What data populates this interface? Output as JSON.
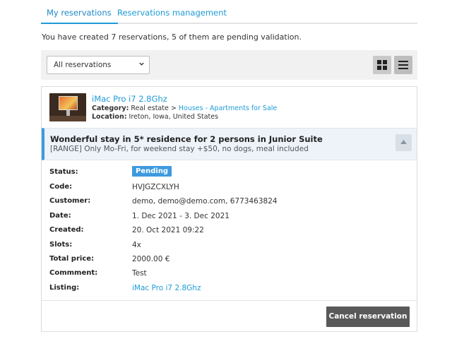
{
  "tabs": [
    {
      "label": "My reservations",
      "active": true
    },
    {
      "label": "Reservations management",
      "active": false
    }
  ],
  "summary": "You have created 7 reservations, 5 of them are pending validation.",
  "filter": {
    "selected": "All reservations",
    "options": [
      "All reservations"
    ]
  },
  "view_toggle": {
    "grid_icon": "grid-view-icon",
    "list_icon": "list-view-icon",
    "active": "list"
  },
  "listing": {
    "title": "iMac Pro i7 2.8Ghz",
    "category_label": "Category:",
    "category_parent": "Real estate",
    "category_separator": ">",
    "category_child": "Houses - Apartments for Sale",
    "location_label": "Location:",
    "location": "Ireton, Iowa, United States"
  },
  "offer": {
    "title": "Wonderful stay in 5* residence for 2 persons in Junior Suite",
    "description": "[RANGE] Only Mo-Fri, for weekend stay +$50, no dogs, meal included"
  },
  "details": [
    {
      "label": "Status:",
      "value": "Pending",
      "type": "badge"
    },
    {
      "label": "Code:",
      "value": "HVJGZCXLYH"
    },
    {
      "label": "Customer:",
      "value": "demo, demo@demo.com, 6773463824"
    },
    {
      "label": "Date:",
      "value": "1. Dec 2021 - 3. Dec 2021"
    },
    {
      "label": "Created:",
      "value": "20. Oct 2021 09:22"
    },
    {
      "label": "Slots:",
      "value": "4x"
    },
    {
      "label": "Total price:",
      "value": "2000.00 €"
    },
    {
      "label": "Commment:",
      "value": "Test"
    },
    {
      "label": "Listing:",
      "value": "iMac Pro i7 2.8Ghz",
      "type": "link"
    }
  ],
  "cancel_label": "Cancel reservation",
  "colors": {
    "accent": "#1e9bd7",
    "badge": "#3d9ae0",
    "button": "#595959"
  }
}
